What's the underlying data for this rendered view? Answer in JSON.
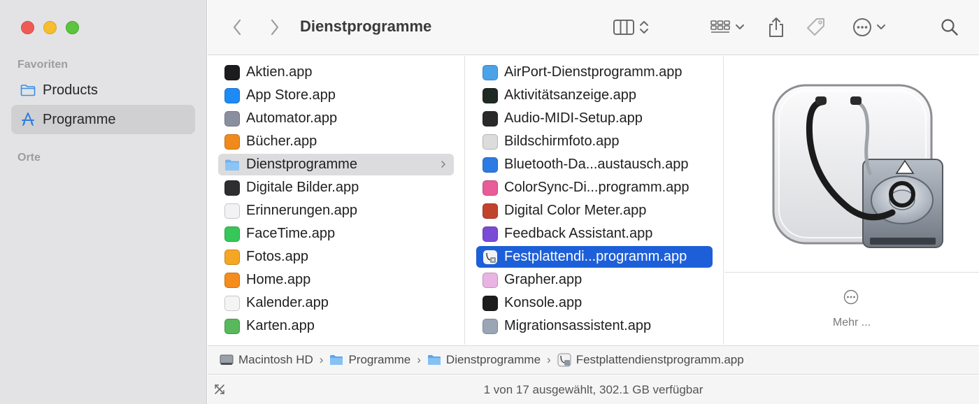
{
  "window": {
    "title": "Dienstprogramme"
  },
  "sidebar": {
    "sections": [
      {
        "label": "Favoriten"
      },
      {
        "label": "Orte"
      }
    ],
    "items": [
      {
        "label": "Products",
        "icon": "folder-icon",
        "selected": false
      },
      {
        "label": "Programme",
        "icon": "applications-icon",
        "selected": true
      }
    ]
  },
  "toolbar": {
    "back": "back-icon",
    "forward": "forward-icon",
    "view_mode": "columns-view-icon",
    "group": "grid-group-icon",
    "share": "share-icon",
    "tags": "tag-icon",
    "more": "more-icon",
    "search": "search-icon"
  },
  "column1": {
    "items": [
      {
        "label": "Aktien.app",
        "color": "#1c1c1e"
      },
      {
        "label": "App Store.app",
        "color": "#1e8bf5"
      },
      {
        "label": "Automator.app",
        "color": "#8a8fa0"
      },
      {
        "label": "Bücher.app",
        "color": "#f08a1c"
      },
      {
        "label": "Dienstprogramme",
        "color": "#6fb3ef",
        "highlight": "grey",
        "folder": true
      },
      {
        "label": "Digitale Bilder.app",
        "color": "#2e2e30"
      },
      {
        "label": "Erinnerungen.app",
        "color": "#f2f2f4"
      },
      {
        "label": "FaceTime.app",
        "color": "#35c759"
      },
      {
        "label": "Fotos.app",
        "color": "#f5a623"
      },
      {
        "label": "Home.app",
        "color": "#f58c1b"
      },
      {
        "label": "Kalender.app",
        "color": "#f4f4f4"
      },
      {
        "label": "Karten.app",
        "color": "#58b85c"
      }
    ]
  },
  "column2": {
    "items": [
      {
        "label": "AirPort-Dienstprogramm.app",
        "color": "#4aa3e8"
      },
      {
        "label": "Aktivitätsanzeige.app",
        "color": "#1f2a24"
      },
      {
        "label": "Audio-MIDI-Setup.app",
        "color": "#2a2a2a"
      },
      {
        "label": "Bildschirmfoto.app",
        "color": "#dcdcdc"
      },
      {
        "label": "Bluetooth-Da...austausch.app",
        "color": "#2c7be5"
      },
      {
        "label": "ColorSync-Di...programm.app",
        "color": "#e85c9a"
      },
      {
        "label": "Digital Color Meter.app",
        "color": "#c2432b"
      },
      {
        "label": "Feedback Assistant.app",
        "color": "#7a4bd6"
      },
      {
        "label": "Festplattendi...programm.app",
        "color": "#e8e8ea",
        "highlight": "blue"
      },
      {
        "label": "Grapher.app",
        "color": "#e9b3e3"
      },
      {
        "label": "Konsole.app",
        "color": "#1d1d1d"
      },
      {
        "label": "Migrationsassistent.app",
        "color": "#9aa6b5"
      }
    ]
  },
  "preview": {
    "icon": "disk-utility-icon",
    "more_label": "Mehr ..."
  },
  "pathbar": {
    "crumbs": [
      {
        "label": "Macintosh HD",
        "icon": "harddisk-icon"
      },
      {
        "label": "Programme",
        "icon": "folder-icon"
      },
      {
        "label": "Dienstprogramme",
        "icon": "folder-icon"
      },
      {
        "label": "Festplattendienstprogramm.app",
        "icon": "disk-utility-icon"
      }
    ],
    "separator": "›"
  },
  "statusbar": {
    "text": "1 von 17 ausgewählt, 302.1 GB verfügbar"
  },
  "colors": {
    "accent": "#1d5fd8",
    "sidebar_bg": "#e3e3e5",
    "folder": "#4a9ee8"
  }
}
